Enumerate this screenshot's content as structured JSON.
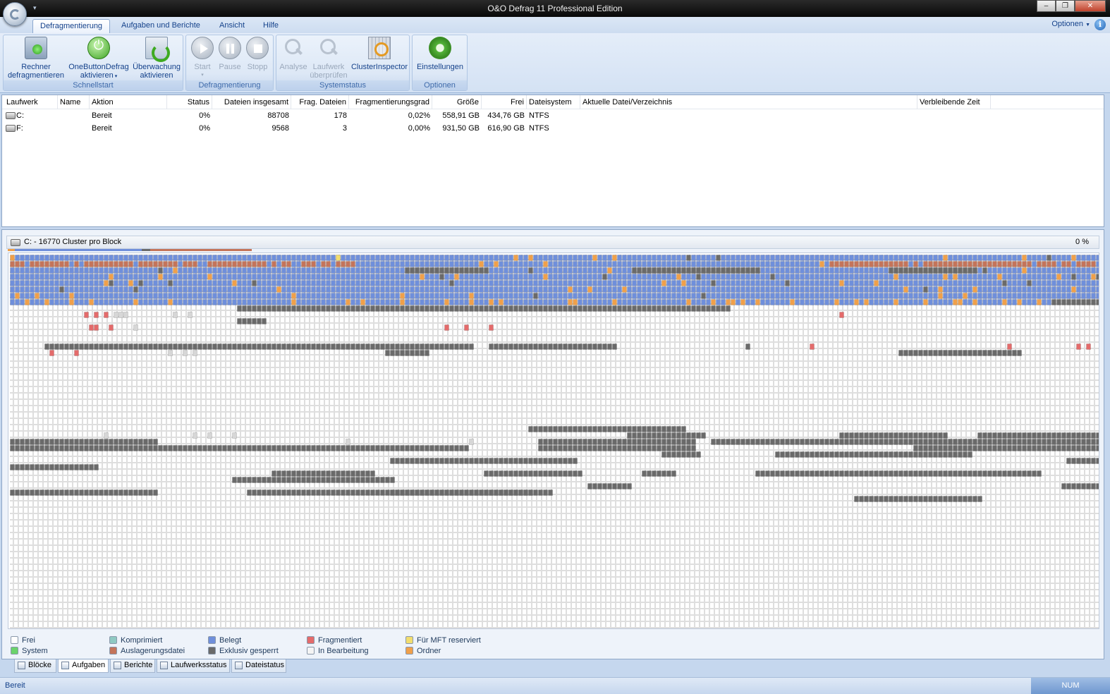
{
  "window": {
    "title": "O&O Defrag 11 Professional Edition",
    "minimize": "–",
    "maximize": "❐",
    "close": "✕"
  },
  "ribbon": {
    "tabs": [
      "Defragmentierung",
      "Aufgaben und Berichte",
      "Ansicht",
      "Hilfe"
    ],
    "active_tab": 0,
    "options_label": "Optionen",
    "help_glyph": "i",
    "groups": {
      "schnellstart": {
        "label": "Schnellstart",
        "rechner_l1": "Rechner",
        "rechner_l2": "defragmentieren",
        "onebutton_l1": "OneButtonDefrag",
        "onebutton_l2": "aktivieren",
        "ueberwachung_l1": "Überwachung",
        "ueberwachung_l2": "aktivieren"
      },
      "defragmentierung": {
        "label": "Defragmentierung",
        "start": "Start",
        "pause": "Pause",
        "stopp": "Stopp"
      },
      "systemstatus": {
        "label": "Systemstatus",
        "analyse": "Analyse",
        "laufwerk_l1": "Laufwerk",
        "laufwerk_l2": "überprüfen",
        "clusterinspector": "ClusterInspector"
      },
      "optionen": {
        "label": "Optionen",
        "einstellungen": "Einstellungen"
      }
    }
  },
  "drive_list": {
    "columns": {
      "laufwerk": "Laufwerk",
      "name": "Name",
      "aktion": "Aktion",
      "status": "Status",
      "dateien": "Dateien insgesamt",
      "frag": "Frag. Dateien",
      "fraggrad": "Fragmentierungsgrad",
      "groesse": "Größe",
      "frei": "Frei",
      "dateisystem": "Dateisystem",
      "aktuelle": "Aktuelle Datei/Verzeichnis",
      "verbleibend": "Verbleibende Zeit"
    },
    "rows": [
      {
        "laufwerk": "C:",
        "name": "",
        "aktion": "Bereit",
        "status": "0%",
        "dateien": "88708",
        "frag": "178",
        "fraggrad": "0,02%",
        "groesse": "558,91 GB",
        "frei": "434,76 GB",
        "dateisystem": "NTFS",
        "aktuelle": "",
        "verbleibend": ""
      },
      {
        "laufwerk": "F:",
        "name": "",
        "aktion": "Bereit",
        "status": "0%",
        "dateien": "9568",
        "frag": "3",
        "fraggrad": "0,00%",
        "groesse": "931,50 GB",
        "frei": "616,90 GB",
        "dateisystem": "NTFS",
        "aktuelle": "",
        "verbleibend": ""
      }
    ]
  },
  "cluster_map": {
    "title": "C: - 16770 Cluster pro Block",
    "percent": "0 %"
  },
  "legend": {
    "frei": "Frei",
    "system": "System",
    "komprimiert": "Komprimiert",
    "auslagerung": "Auslagerungsdatei",
    "belegt": "Belegt",
    "exklusiv": "Exklusiv gesperrt",
    "fragmentiert": "Fragmentiert",
    "inbearbeitung": "In Bearbeitung",
    "mft": "Für MFT reserviert",
    "ordner": "Ordner"
  },
  "colors": {
    "frei": "#ffffff",
    "system": "#6bd36b",
    "komprimiert": "#8fc9c2",
    "auslagerung": "#c4745a",
    "belegt": "#6f8fdb",
    "exklusiv": "#6a6a6a",
    "fragmentiert": "#e46b6b",
    "inbearbeitung": "#f4f4f4",
    "mft": "#f2dd6e",
    "ordner": "#f0a04a"
  },
  "bottom_tabs": [
    "Blöcke",
    "Aufgaben",
    "Berichte",
    "Laufwerksstatus",
    "Dateistatus"
  ],
  "active_bottom_tab": 1,
  "status": {
    "text": "Bereit",
    "num": "NUM"
  }
}
